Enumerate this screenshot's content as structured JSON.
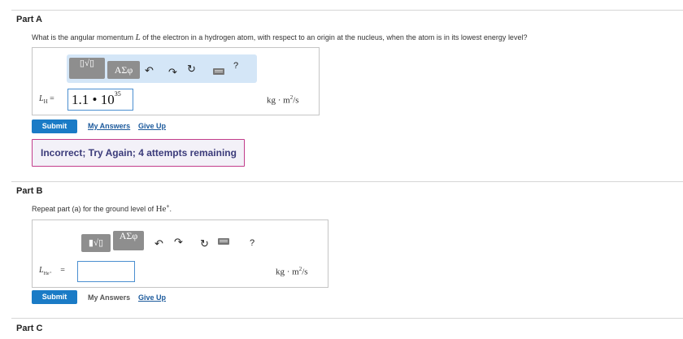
{
  "partA": {
    "title": "Part A",
    "question_pre": "What is the angular momentum ",
    "question_var": "L",
    "question_post": " of the electron in a hydrogen atom, with respect to an origin at the nucleus, when the atom is in its lowest energy level?",
    "lhs_var": "L",
    "lhs_sub": "H",
    "lhs_eq": "=",
    "answer_mantissa": "1.1 • 10",
    "answer_exp": "35",
    "unit_base": "kg · m",
    "unit_exp": "2",
    "unit_tail": "/s",
    "submit_label": "Submit",
    "my_answers_label": "My Answers",
    "give_up_label": "Give Up",
    "feedback": "Incorrect; Try Again; 4 attempts remaining",
    "toolbar": {
      "greek_label": "ΑΣφ",
      "help_label": "?"
    }
  },
  "partB": {
    "title": "Part B",
    "question_pre": "Repeat part (a) for the ground level of ",
    "question_species": "He",
    "question_charge": "+",
    "question_post": ".",
    "lhs_var": "L",
    "lhs_sub": "He⁺",
    "lhs_eq": "=",
    "input_value": "",
    "unit_base": "kg · m",
    "unit_exp": "2",
    "unit_tail": "/s",
    "submit_label": "Submit",
    "my_answers_label": "My Answers",
    "give_up_label": "Give Up",
    "toolbar": {
      "greek_label": "ΑΣφ",
      "help_label": "?"
    }
  },
  "partC": {
    "title": "Part C"
  },
  "colors": {
    "accent": "#1a7bc6",
    "toolbar_bg": "#d4e6f7",
    "feedback_border": "#c23d8b"
  }
}
